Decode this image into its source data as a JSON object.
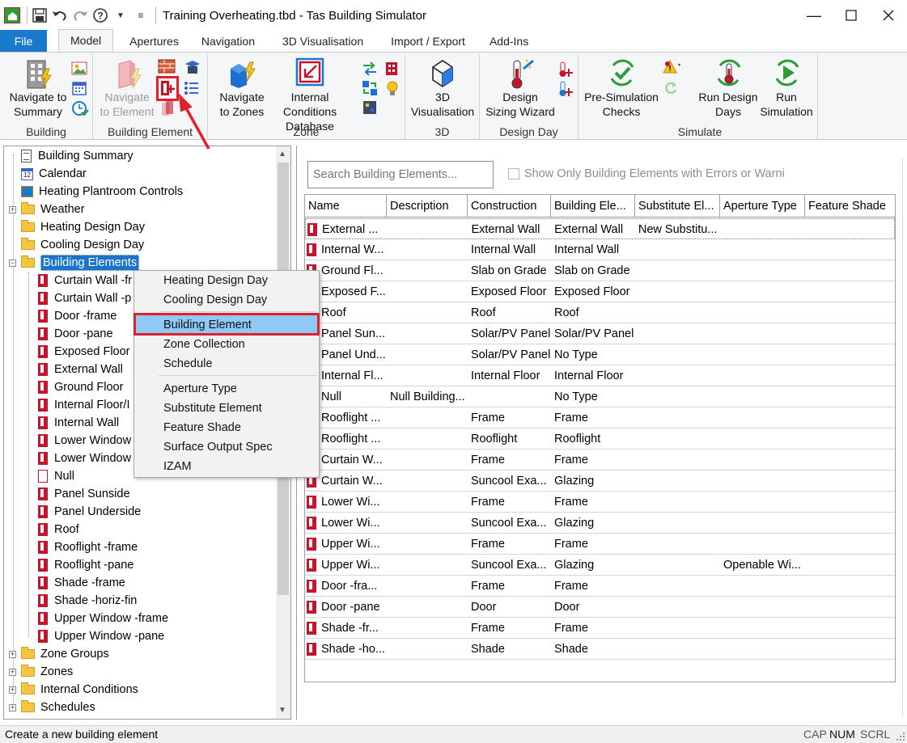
{
  "window": {
    "title": "Training Overheating.tbd - Tas Building Simulator",
    "controls": [
      "minimize",
      "maximize",
      "close"
    ]
  },
  "quick_access": {
    "icons": [
      "app-icon",
      "save-icon",
      "undo-icon",
      "redo-icon",
      "help-icon",
      "dropdown-icon"
    ]
  },
  "tabs": [
    "File",
    "Model",
    "Apertures",
    "Navigation",
    "3D Visualisation",
    "Import / Export",
    "Add-Ins"
  ],
  "active_tab": "Model",
  "ribbon": {
    "groups": [
      {
        "label": "Building",
        "buttons": [
          {
            "label1": "Navigate to",
            "label2": "Summary"
          }
        ]
      },
      {
        "label": "Building Element",
        "buttons": [
          {
            "label1": "Navigate",
            "label2": "to Element",
            "disabled": true
          }
        ]
      },
      {
        "label": "Zone",
        "buttons": [
          {
            "label1": "Navigate",
            "label2": "to Zones"
          },
          {
            "label1": "Internal Conditions",
            "label2": "Database"
          }
        ]
      },
      {
        "label": "3D",
        "buttons": [
          {
            "label1": "3D",
            "label2": "Visualisation"
          }
        ]
      },
      {
        "label": "Design Day",
        "buttons": [
          {
            "label1": "Design",
            "label2": "Sizing Wizard"
          }
        ]
      },
      {
        "label": "Simulate",
        "buttons": [
          {
            "label1": "Pre-Simulation",
            "label2": "Checks"
          },
          {
            "label1": "Run Design",
            "label2": "Days"
          },
          {
            "label1": "Run",
            "label2": "Simulation"
          }
        ]
      }
    ]
  },
  "tree": {
    "items": [
      {
        "label": "Building Summary",
        "icon": "building-summary-icon",
        "level": 0,
        "expander": ""
      },
      {
        "label": "Calendar",
        "icon": "calendar-icon",
        "level": 0,
        "expander": ""
      },
      {
        "label": "Heating Plantroom Controls",
        "icon": "plantroom-icon",
        "level": 0,
        "expander": ""
      },
      {
        "label": "Weather",
        "icon": "folder-icon",
        "level": 0,
        "expander": "+"
      },
      {
        "label": "Heating Design Day",
        "icon": "folder-icon",
        "level": 0,
        "expander": ""
      },
      {
        "label": "Cooling Design Day",
        "icon": "folder-icon",
        "level": 0,
        "expander": ""
      },
      {
        "label": "Building Elements",
        "icon": "folder-icon",
        "level": 0,
        "expander": "−",
        "selected": true
      },
      {
        "label": "Curtain Wall -fr",
        "icon": "element-icon",
        "level": 1
      },
      {
        "label": "Curtain Wall -p",
        "icon": "element-icon",
        "level": 1
      },
      {
        "label": "Door -frame",
        "icon": "element-icon",
        "level": 1
      },
      {
        "label": "Door -pane",
        "icon": "element-icon",
        "level": 1
      },
      {
        "label": "Exposed Floor",
        "icon": "element-icon",
        "level": 1
      },
      {
        "label": "External Wall",
        "icon": "element-icon",
        "level": 1
      },
      {
        "label": "Ground Floor",
        "icon": "element-icon",
        "level": 1
      },
      {
        "label": "Internal Floor/I",
        "icon": "element-icon",
        "level": 1
      },
      {
        "label": "Internal Wall",
        "icon": "element-icon",
        "level": 1
      },
      {
        "label": "Lower Window",
        "icon": "element-icon",
        "level": 1
      },
      {
        "label": "Lower Window",
        "icon": "element-icon",
        "level": 1
      },
      {
        "label": "Null",
        "icon": "null-element-icon",
        "level": 1
      },
      {
        "label": "Panel Sunside",
        "icon": "element-icon",
        "level": 1
      },
      {
        "label": "Panel Underside",
        "icon": "element-icon",
        "level": 1
      },
      {
        "label": "Roof",
        "icon": "element-icon",
        "level": 1
      },
      {
        "label": "Rooflight -frame",
        "icon": "element-icon",
        "level": 1
      },
      {
        "label": "Rooflight -pane",
        "icon": "element-icon",
        "level": 1
      },
      {
        "label": "Shade -frame",
        "icon": "element-icon",
        "level": 1
      },
      {
        "label": "Shade -horiz-fin",
        "icon": "element-icon",
        "level": 1
      },
      {
        "label": "Upper Window -frame",
        "icon": "element-icon",
        "level": 1
      },
      {
        "label": "Upper Window -pane",
        "icon": "element-icon",
        "level": 1
      },
      {
        "label": "Zone Groups",
        "icon": "folder-icon",
        "level": 0,
        "expander": "+"
      },
      {
        "label": "Zones",
        "icon": "folder-icon",
        "level": 0,
        "expander": "+"
      },
      {
        "label": "Internal Conditions",
        "icon": "folder-icon",
        "level": 0,
        "expander": "+"
      },
      {
        "label": "Schedules",
        "icon": "folder-icon",
        "level": 0,
        "expander": "+"
      }
    ]
  },
  "context_menu": {
    "items": [
      {
        "label": "Heating Design Day"
      },
      {
        "label": "Cooling Design Day"
      },
      {
        "label": "Building Element",
        "highlighted": true
      },
      {
        "label": "Zone Collection"
      },
      {
        "label": "Schedule"
      },
      {
        "label": "Aperture Type"
      },
      {
        "label": "Substitute Element"
      },
      {
        "label": "Feature Shade"
      },
      {
        "label": "Surface Output Spec"
      },
      {
        "label": "IZAM"
      }
    ]
  },
  "search": {
    "placeholder": "Search Building Elements...",
    "checkbox_label": "Show Only Building Elements with Errors or Warni"
  },
  "grid": {
    "columns": [
      "Name",
      "Description",
      "Construction",
      "Building Ele...",
      "Substitute El...",
      "Aperture Type",
      "Feature Shade"
    ],
    "rows": [
      [
        "External ...",
        "",
        "External Wall",
        "External Wall",
        "New Substitu...",
        "",
        ""
      ],
      [
        "Internal W...",
        "",
        "Internal Wall",
        "Internal Wall",
        "",
        "",
        ""
      ],
      [
        "Ground Fl...",
        "",
        "Slab on Grade",
        "Slab on Grade",
        "",
        "",
        ""
      ],
      [
        "Exposed F...",
        "",
        "Exposed Floor",
        "Exposed Floor",
        "",
        "",
        ""
      ],
      [
        "Roof",
        "",
        "Roof",
        "Roof",
        "",
        "",
        ""
      ],
      [
        "Panel Sun...",
        "",
        "Solar/PV Panel",
        "Solar/PV Panel",
        "",
        "",
        ""
      ],
      [
        "Panel Und...",
        "",
        "Solar/PV Panel",
        "No Type",
        "",
        "",
        ""
      ],
      [
        "Internal Fl...",
        "",
        "Internal Floor",
        "Internal Floor",
        "",
        "",
        ""
      ],
      [
        "Null",
        "Null Building...",
        "",
        "No Type",
        "",
        "",
        ""
      ],
      [
        "Rooflight ...",
        "",
        "Frame",
        "Frame",
        "",
        "",
        ""
      ],
      [
        "Rooflight ...",
        "",
        "Rooflight",
        "Rooflight",
        "",
        "",
        ""
      ],
      [
        "Curtain W...",
        "",
        "Frame",
        "Frame",
        "",
        "",
        ""
      ],
      [
        "Curtain W...",
        "",
        "Suncool Exa...",
        "Glazing",
        "",
        "",
        ""
      ],
      [
        "Lower Wi...",
        "",
        "Frame",
        "Frame",
        "",
        "",
        ""
      ],
      [
        "Lower Wi...",
        "",
        "Suncool Exa...",
        "Glazing",
        "",
        "",
        ""
      ],
      [
        "Upper Wi...",
        "",
        "Frame",
        "Frame",
        "",
        "",
        ""
      ],
      [
        "Upper Wi...",
        "",
        "Suncool Exa...",
        "Glazing",
        "",
        "Openable Wi...",
        ""
      ],
      [
        "Door -fra...",
        "",
        "Frame",
        "Frame",
        "",
        "",
        ""
      ],
      [
        "Door -pane",
        "",
        "Door",
        "Door",
        "",
        "",
        ""
      ],
      [
        "Shade -fr...",
        "",
        "Frame",
        "Frame",
        "",
        "",
        ""
      ],
      [
        "Shade -ho...",
        "",
        "Shade",
        "Shade",
        "",
        "",
        ""
      ]
    ]
  },
  "statusbar": {
    "text": "Create a new building element",
    "indicators": [
      "CAP",
      "NUM",
      "SCRL"
    ]
  },
  "colors": {
    "accent": "#1979ca",
    "selection": "#1a74c9",
    "menu_highlight": "#90c8f6",
    "annotation_red": "#e0202a",
    "element_red": "#c5152b"
  }
}
